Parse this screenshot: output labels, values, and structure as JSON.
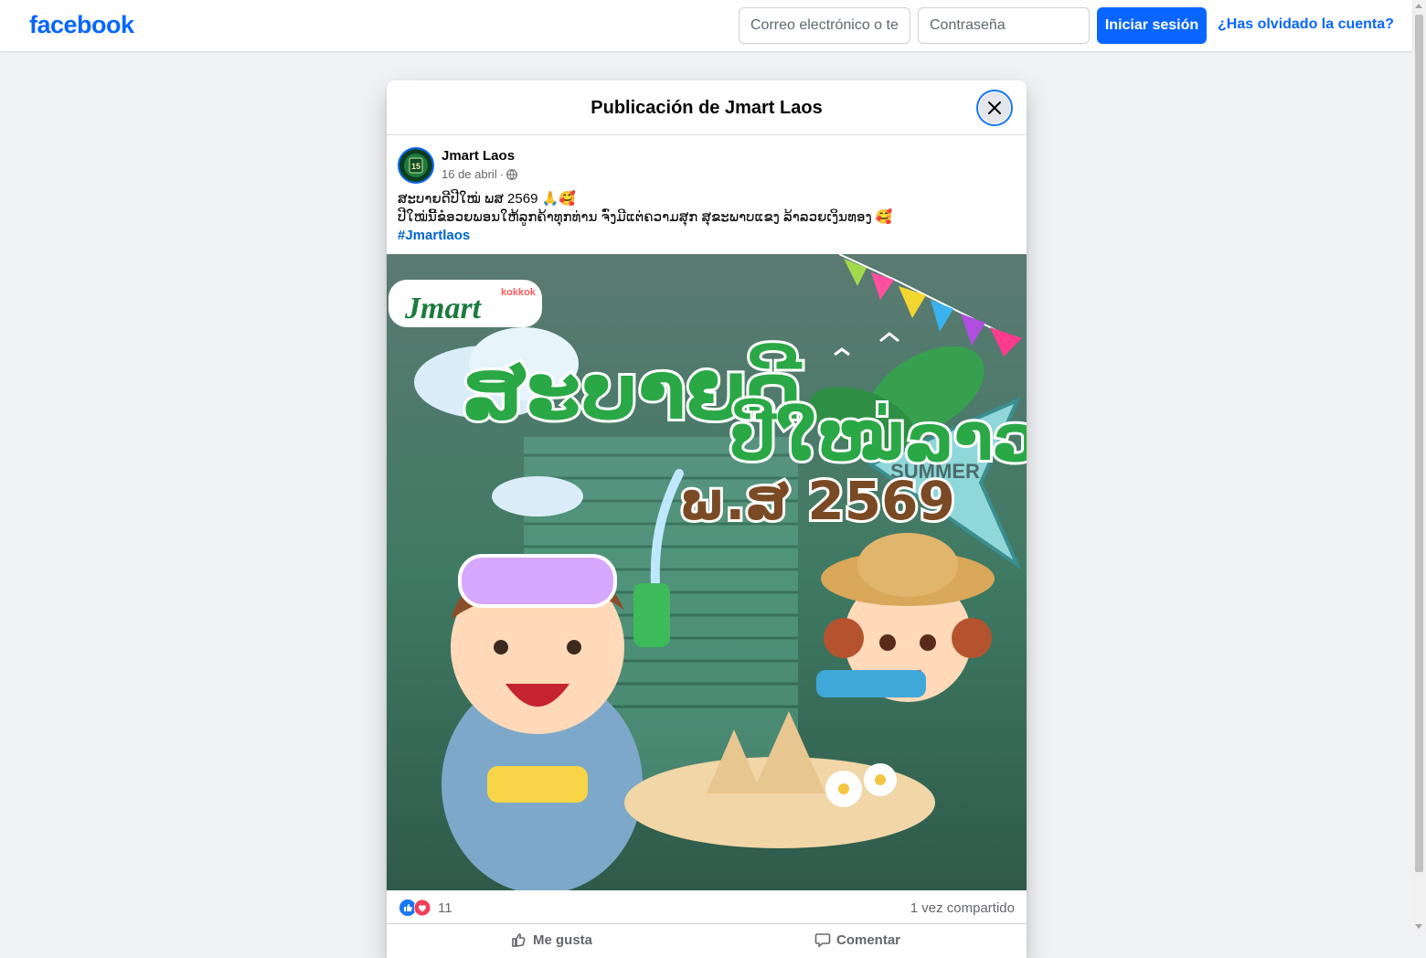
{
  "brand": {
    "logo_text": "facebook",
    "accent": "#0866ff"
  },
  "login": {
    "email_placeholder": "Correo electrónico o teléfono",
    "password_placeholder": "Contraseña",
    "login_button": "Iniciar sesión",
    "forgot_link": "¿Has olvidado la cuenta?"
  },
  "modal": {
    "title": "Publicación de Jmart Laos",
    "close_icon": "close-icon"
  },
  "post": {
    "author": "Jmart Laos",
    "date": "16 de abril",
    "separator": "·",
    "privacy_icon": "globe-icon",
    "text_line1": "ສະບາຍດີປີໃໝ່ ພສ 2569 🙏🥰",
    "text_line2": "ປີໃໝ່ນີ້ຂໍອວຍພອນໃຫ້ລູກຄ້າທຸກທ່ານ ຈົ່ງມີແຕ່ຄວາມສຸກ ສຸຂະພາບແຂງ ລ້າລວຍເງິນທອງ 🥰",
    "hashtag": "#Jmartlaos",
    "image": {
      "brand_label": "Jmart",
      "sub_brand": "kokkok",
      "headline_line1": "ສະບາຍດີ",
      "headline_line2": "ປີໃໝ່ລາວ",
      "headline_line3": "ພ.ສ 2569",
      "banner_text": "SUMMER"
    },
    "reaction_icons": [
      "like-icon",
      "love-icon"
    ],
    "reaction_count": "11",
    "shares": "1 vez compartido",
    "actions": {
      "like": "Me gusta",
      "comment": "Comentar"
    }
  }
}
